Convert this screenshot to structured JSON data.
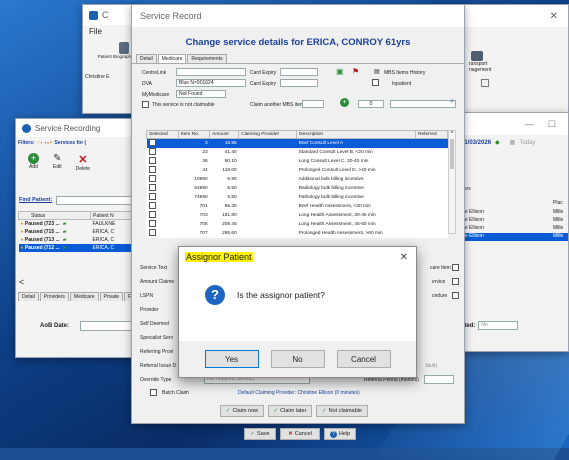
{
  "back_window": {
    "title": "C",
    "menu": "File",
    "patient_biog": "Patient Biograph",
    "christine": "Christine E"
  },
  "right_window": {
    "transport": "ransport",
    "management": "nagement",
    "date": "01/03/2026",
    "today": "Today",
    "col_ders": "ders",
    "col_plac": "Plac",
    "col_mile": "Mille",
    "rows": [
      "ine Ellison",
      "ine Ellison",
      "ine Ellison",
      "ine Ellison"
    ],
    "ated_label": "ated:",
    "ated_value": "No"
  },
  "service_recording": {
    "title": "Service Recording",
    "filters_label": "Filters:",
    "services_for": "Services for (",
    "add": "Add",
    "edit": "Edit",
    "delete": "Delete",
    "m": "M",
    "find_patient": "Find Patient:",
    "col_status": "Status",
    "col_patient": "Patient N",
    "rows": [
      {
        "status": "Paused (723 ...",
        "patient": "FAULKNE"
      },
      {
        "status": "Paused (715 ...",
        "patient": "ERICA, C"
      },
      {
        "status": "Paused (713 ...",
        "patient": "ERICA, C"
      },
      {
        "status": "Paused (712 ...",
        "patient": "ERICA, C"
      }
    ],
    "tabs": [
      "Detail",
      "Providers",
      "Medicare",
      "Private",
      "F"
    ],
    "aob_date": "AoB Date:"
  },
  "service_record": {
    "window_title": "Service Record",
    "heading": "Change service details for ERICA, CONROY 61yrs",
    "tabs": [
      "Detail",
      "Medicare",
      "Requirements"
    ],
    "centrelink_label": "CentreLink",
    "card_expiry_label": "Card Expiry",
    "card_expiry2_label": "Card Expiry",
    "mbs_history": "MBS Items History",
    "inpatient": "Inpatient",
    "dva_label": "DVA",
    "dva_value": "Blue N×901624",
    "mymedicare_label": "MyMedicare",
    "mymedicare_value": "Not Found",
    "not_claimable": "This service is not claimable",
    "claim_another": "Claim another MBS item",
    "item_value": "0",
    "service_table": {
      "headers": [
        "Selected",
        "Item No.",
        "Amount",
        "Claiming Provider",
        "Description",
        "Referred"
      ],
      "rows": [
        {
          "item": "3",
          "amount": "18.95",
          "desc": "Brief Consult Level A"
        },
        {
          "item": "23",
          "amount": "41.40",
          "desc": "Standard Consult Level B, <20 min"
        },
        {
          "item": "36",
          "amount": "80.10",
          "desc": "Long Consult Level C, 20-40 min"
        },
        {
          "item": "44",
          "amount": "118.00",
          "desc": "Prolonged Consult Level D, >40 min"
        },
        {
          "item": "10990",
          "amount": "6.90",
          "desc": "Additional bulk billing incentive"
        },
        {
          "item": "64990",
          "amount": "6.50",
          "desc": "Radiology bulk billing incentive"
        },
        {
          "item": "74990",
          "amount": "6.50",
          "desc": "Pathology bulk billing incentive"
        },
        {
          "item": "701",
          "amount": "65.30",
          "desc": "Brief Health Assessment, <30 min"
        },
        {
          "item": "703",
          "amount": "151.80",
          "desc": "Long Health Assessment, 30-45 min"
        },
        {
          "item": "705",
          "amount": "209.45",
          "desc": "Long Health Assessment, 45-60 min"
        },
        {
          "item": "707",
          "amount": "295.60",
          "desc": "Prolonged Health Assessment, >60 min"
        }
      ]
    },
    "service_text": "Service Text",
    "amount_claimed": "Amount Claime",
    "lspn": "LSPN",
    "provider": "Provider",
    "self_deemed": "Self Deemed",
    "specialist": "Specialist Serv",
    "referring": "Referring Provi",
    "referral_issue": "Referral Issue D",
    "override_type": "Override Type",
    "override_value": "Not required (default)",
    "referral_period": "Referral Period (months)",
    "fault": "fault)",
    "batch_claim": "Batch Claim",
    "default_provider": "Default Claiming Provider: Christine Ellison (0 minutes)",
    "claim_now": "Claim now",
    "claim_later": "Claim later",
    "not_claimable_btn": "Not claimable",
    "save": "Save",
    "cancel": "Cancel",
    "help": "Help",
    "care_item": "care Item",
    "ervice": "ervice",
    "cedure": "cedure"
  },
  "dialog": {
    "title": "Assignor Patient",
    "close": "✕",
    "question": "Is the assignor patient?",
    "yes": "Yes",
    "no": "No",
    "cancel": "Cancel"
  },
  "colors": {
    "accent": "#0a5cd6",
    "heading": "#1a3f9c",
    "dialog_title_bg": "#fff200"
  }
}
